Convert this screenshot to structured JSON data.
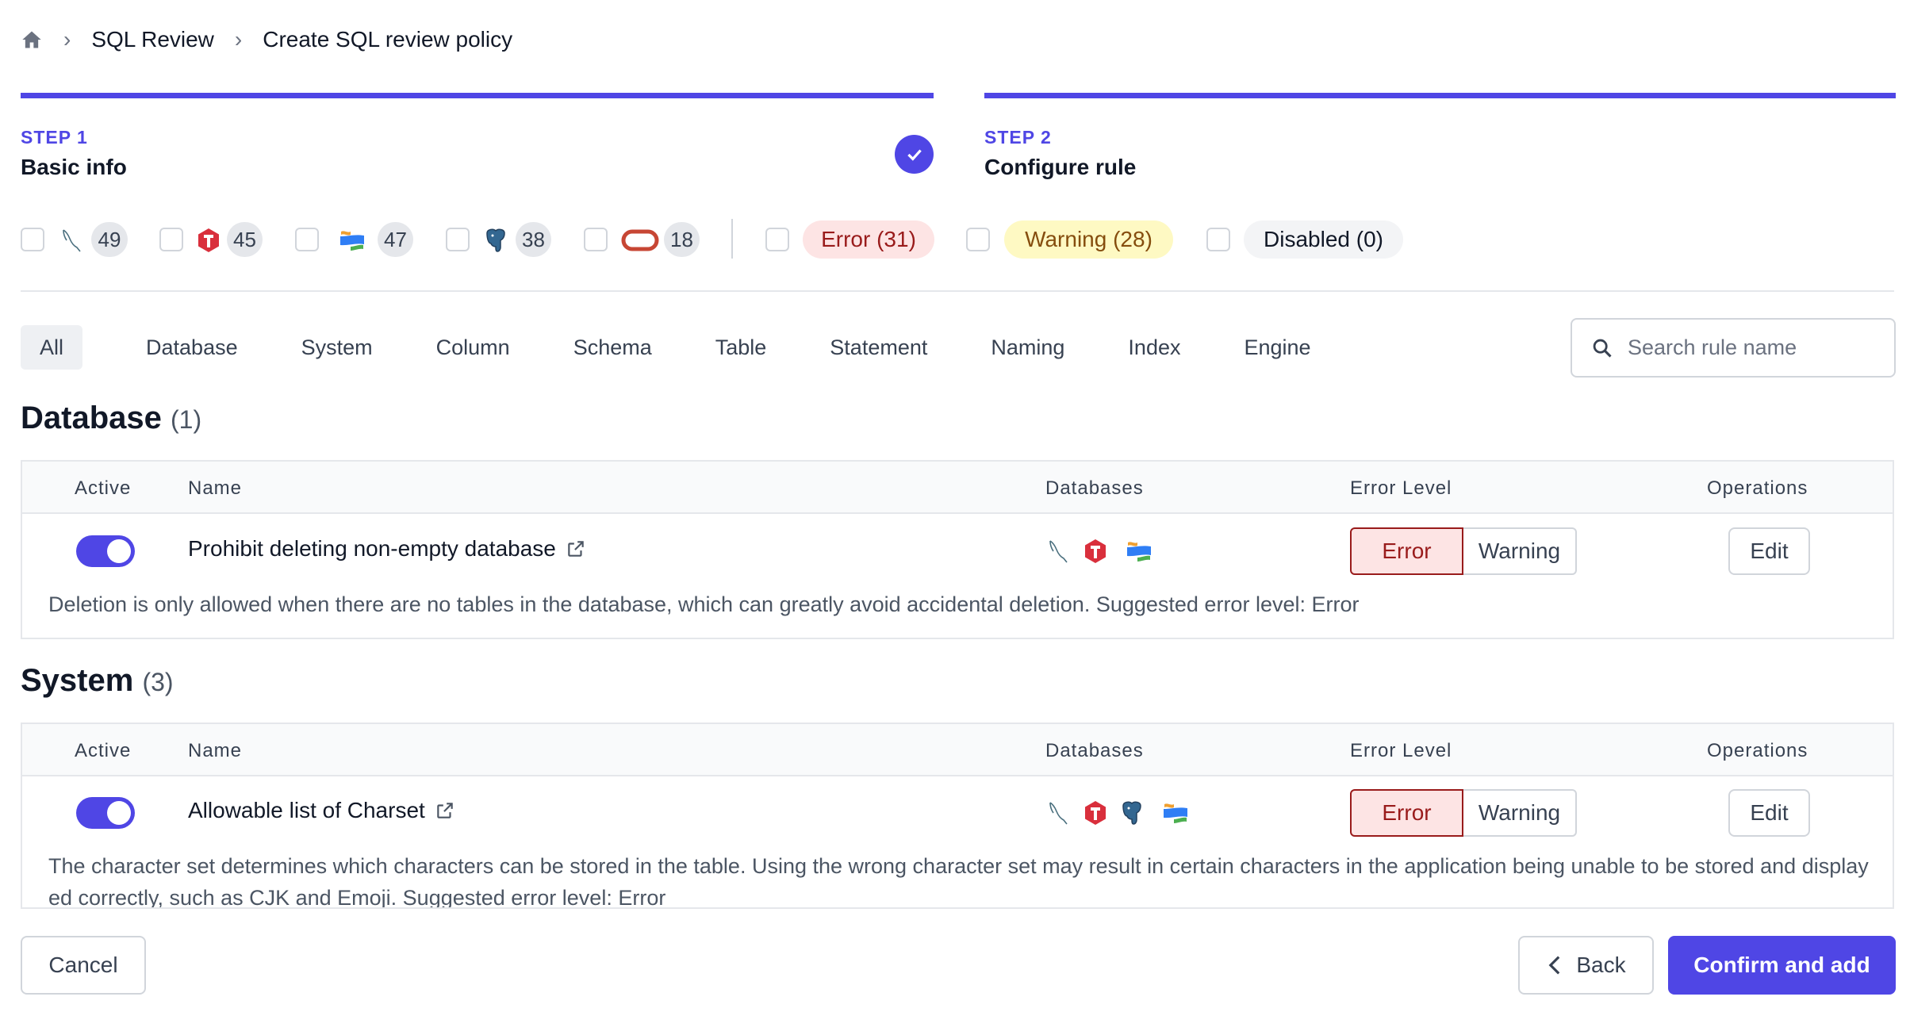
{
  "breadcrumb": {
    "items": [
      "SQL Review",
      "Create SQL review policy"
    ]
  },
  "steps": [
    {
      "label": "STEP 1",
      "title": "Basic info",
      "completed": true
    },
    {
      "label": "STEP 2",
      "title": "Configure rule",
      "completed": false
    }
  ],
  "filters": {
    "engines": [
      {
        "icon": "mysql-icon",
        "count": "49"
      },
      {
        "icon": "tidb-icon",
        "count": "45"
      },
      {
        "icon": "snowflake-icon",
        "count": "47"
      },
      {
        "icon": "postgres-icon",
        "count": "38"
      },
      {
        "icon": "oracle-icon",
        "count": "18"
      }
    ],
    "levels": [
      {
        "label": "Error (31)",
        "color": "#991b1b"
      },
      {
        "label": "Warning (28)",
        "color": "#854d0e"
      },
      {
        "label": "Disabled (0)",
        "color": "#111827"
      }
    ]
  },
  "tabs": [
    "All",
    "Database",
    "System",
    "Column",
    "Schema",
    "Table",
    "Statement",
    "Naming",
    "Index",
    "Engine"
  ],
  "search": {
    "placeholder": "Search rule name"
  },
  "columns": {
    "active": "Active",
    "name": "Name",
    "databases": "Databases",
    "level": "Error Level",
    "ops": "Operations"
  },
  "sections": [
    {
      "title": "Database",
      "count": "(1)",
      "rules": [
        {
          "name": "Prohibit deleting non-empty database",
          "active": true,
          "level": "Error",
          "error": "Error",
          "warning": "Warning",
          "edit": "Edit",
          "description": "Deletion is only allowed when there are no tables in the database, which can greatly avoid accidental deletion. Suggested error level: Error"
        }
      ]
    },
    {
      "title": "System",
      "count": "(3)",
      "rules": [
        {
          "name": "Allowable list of Charset",
          "active": true,
          "level": "Error",
          "error": "Error",
          "warning": "Warning",
          "edit": "Edit",
          "description": "The character set determines which characters can be stored in the table. Using the wrong character set may result in certain characters in the application being unable to be stored and displayed correctly, such as CJK and Emoji. Suggested error level: Error"
        }
      ]
    }
  ],
  "footer": {
    "cancel": "Cancel",
    "back": "Back",
    "confirm": "Confirm and add"
  },
  "colors": {
    "accent": "#4f46e5",
    "error_bg": "#fde4e4",
    "warning_bg": "#fef9c3"
  }
}
